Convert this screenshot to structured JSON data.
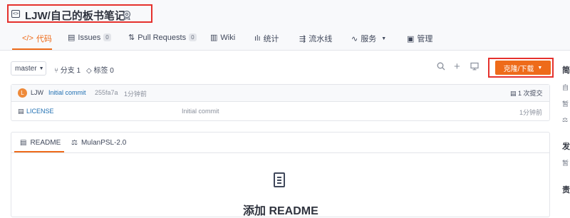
{
  "header": {
    "repo_title": "LJW/自己的板书笔记",
    "repo_icon": "code-repo-icon",
    "badge_icon": "certificate-badge-icon"
  },
  "tabs": [
    {
      "label": "代码",
      "icon": "code-icon",
      "active": true
    },
    {
      "label": "Issues",
      "icon": "issues-icon",
      "count": "0"
    },
    {
      "label": "Pull Requests",
      "icon": "pull-request-icon",
      "count": "0"
    },
    {
      "label": "Wiki",
      "icon": "book-icon"
    },
    {
      "label": "统计",
      "icon": "bar-chart-icon"
    },
    {
      "label": "流水线",
      "icon": "pipeline-icon"
    },
    {
      "label": "服务",
      "icon": "pulse-icon",
      "has_caret": true
    },
    {
      "label": "管理",
      "icon": "settings-icon"
    }
  ],
  "toolbar": {
    "branch": "master",
    "branches_label": "分支 1",
    "tags_label": "标签 0",
    "clone_label": "克隆/下载"
  },
  "commit": {
    "avatar_letter": "L",
    "user": "LJW",
    "message": "Initial commit",
    "hash": "255fa7a",
    "time": "1分钟前",
    "count_label": "1 次提交"
  },
  "files": [
    {
      "name": "LICENSE",
      "message": "Initial commit",
      "time": "1分钟前"
    }
  ],
  "readme": {
    "tabs": [
      {
        "label": "README",
        "icon": "document-icon",
        "active": true
      },
      {
        "label": "MulanPSL-2.0",
        "icon": "scale-icon"
      }
    ],
    "add_label": "添加 README"
  },
  "sidebar_fragments": [
    "简",
    "自",
    "暂",
    "发",
    "暂",
    "责"
  ],
  "colors": {
    "accent": "#ee6b1a",
    "link": "#1f6fb2",
    "highlight": "#e5312d"
  }
}
